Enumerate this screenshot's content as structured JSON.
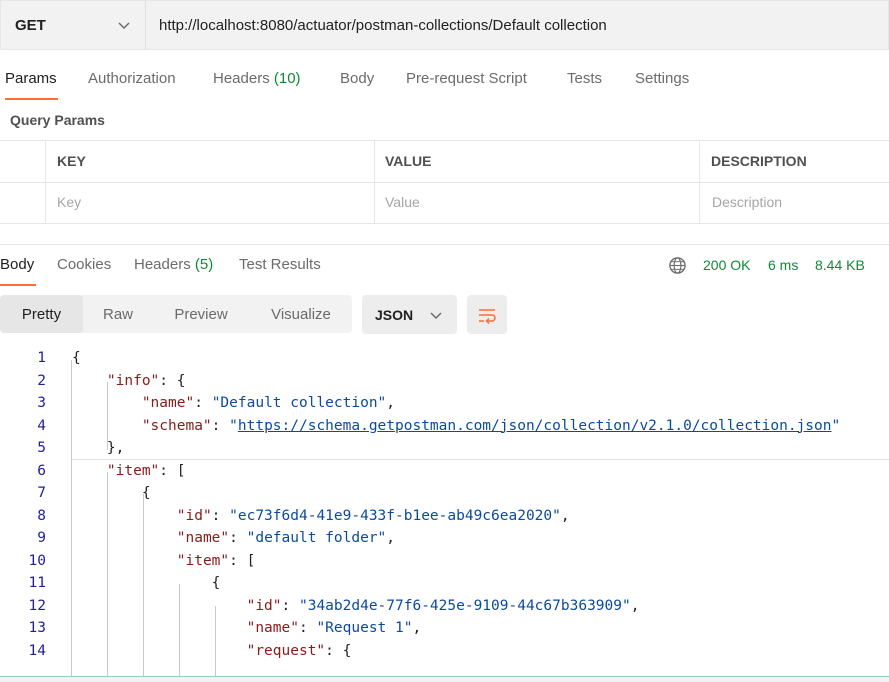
{
  "request": {
    "method": "GET",
    "url": "http://localhost:8080/actuator/postman-collections/Default collection"
  },
  "request_tabs": [
    {
      "label": "Params",
      "active": true
    },
    {
      "label": "Authorization"
    },
    {
      "label": "Headers",
      "count": "(10)"
    },
    {
      "label": "Body"
    },
    {
      "label": "Pre-request Script"
    },
    {
      "label": "Tests"
    },
    {
      "label": "Settings"
    }
  ],
  "query_params": {
    "title": "Query Params",
    "columns": [
      "KEY",
      "VALUE",
      "DESCRIPTION"
    ],
    "placeholders": [
      "Key",
      "Value",
      "Description"
    ]
  },
  "response_tabs": [
    {
      "label": "Body",
      "active": true
    },
    {
      "label": "Cookies"
    },
    {
      "label": "Headers",
      "count": "(5)"
    },
    {
      "label": "Test Results"
    }
  ],
  "response_status": {
    "status": "200 OK",
    "time": "6 ms",
    "size": "8.44 KB"
  },
  "view_modes": [
    "Pretty",
    "Raw",
    "Preview",
    "Visualize"
  ],
  "active_view": "Pretty",
  "format": "JSON",
  "icons": {
    "method_dropdown": "chevron-down-icon",
    "globe": "globe-icon",
    "format_dropdown": "chevron-down-icon",
    "wrap": "wrap-lines-icon"
  },
  "colors": {
    "accent": "#ff6c37",
    "success": "#0f8a37",
    "json_key": "#8a1b1b",
    "json_string": "#0b4a9c",
    "line_number": "#1f1f9a"
  },
  "code_lines": [
    {
      "n": "1",
      "text": "{"
    },
    {
      "n": "2",
      "key": "info",
      "after": ": {"
    },
    {
      "n": "3",
      "key": "name",
      "after": ": ",
      "str": "\"Default collection\"",
      "tail": ","
    },
    {
      "n": "4",
      "key": "schema",
      "after": ": ",
      "link": "https://schema.getpostman.com/json/collection/v2.1.0/collection.json"
    },
    {
      "n": "5",
      "text": "},"
    },
    {
      "n": "6",
      "key": "item",
      "after": ": ["
    },
    {
      "n": "7",
      "text": "{"
    },
    {
      "n": "8",
      "key": "id",
      "after": ": ",
      "str": "\"ec73f6d4-41e9-433f-b1ee-ab49c6ea2020\"",
      "tail": ","
    },
    {
      "n": "9",
      "key": "name",
      "after": ": ",
      "str": "\"default folder\"",
      "tail": ","
    },
    {
      "n": "10",
      "key": "item",
      "after": ": ["
    },
    {
      "n": "11",
      "text": "{"
    },
    {
      "n": "12",
      "key": "id",
      "after": ": ",
      "str": "\"34ab2d4e-77f6-425e-9109-44c67b363909\"",
      "tail": ","
    },
    {
      "n": "13",
      "key": "name",
      "after": ": ",
      "str": "\"Request 1\"",
      "tail": ","
    },
    {
      "n": "14",
      "key": "request",
      "after": ": {"
    }
  ]
}
